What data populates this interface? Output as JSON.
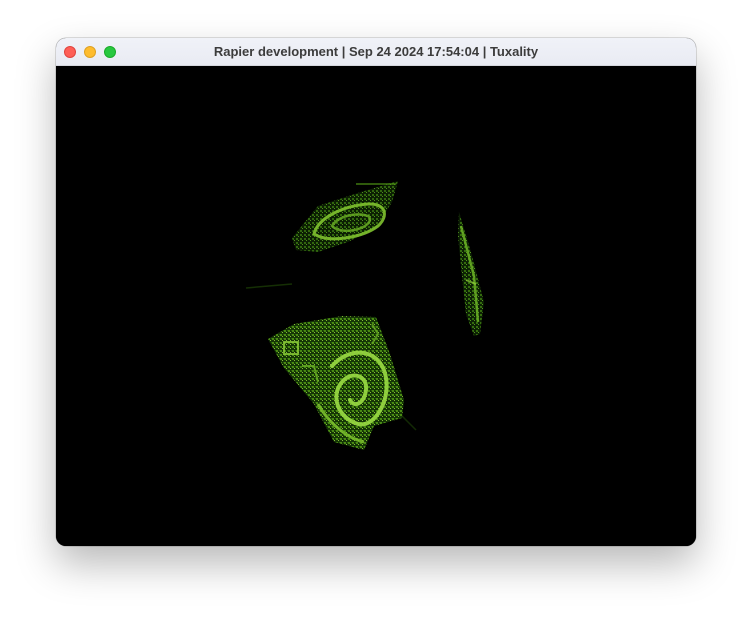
{
  "window": {
    "title": "Rapier development | Sep 24 2024 17:54:04 | Tuxality"
  },
  "titlebar": {
    "close_icon": "close-icon",
    "minimize_icon": "minimize-icon",
    "zoom_icon": "zoom-icon"
  },
  "scene": {
    "object": "textured-cube",
    "background_color": "#000000",
    "texture_color": "#5fa81a"
  }
}
